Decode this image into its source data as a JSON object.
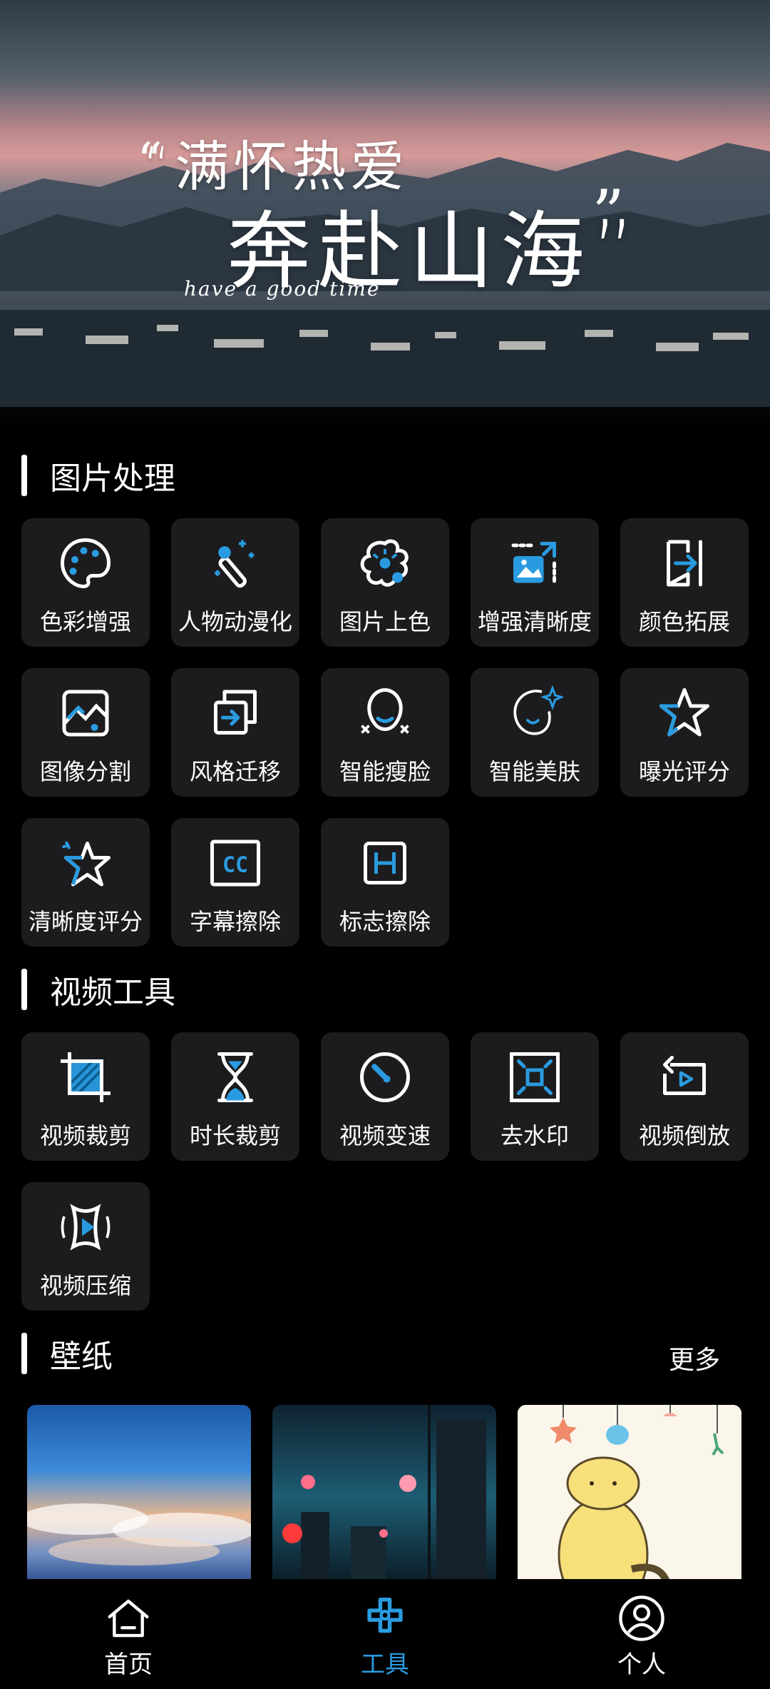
{
  "banner": {
    "line1": "“满怀热爱",
    "line2": "奔赴山海”",
    "sub": "have a good time"
  },
  "sections": {
    "image": {
      "title": "图片处理"
    },
    "video": {
      "title": "视频工具"
    },
    "wallpaper": {
      "title": "壁纸",
      "more": "更多"
    }
  },
  "image_tools": [
    {
      "label": "色彩增强",
      "icon": "palette-icon"
    },
    {
      "label": "人物动漫化",
      "icon": "magic-wand-icon"
    },
    {
      "label": "图片上色",
      "icon": "flower-color-icon"
    },
    {
      "label": "增强清晰度",
      "icon": "image-enhance-icon"
    },
    {
      "label": "颜色拓展",
      "icon": "expand-arrow-icon"
    },
    {
      "label": "图像分割",
      "icon": "image-split-icon"
    },
    {
      "label": "风格迁移",
      "icon": "style-transfer-icon"
    },
    {
      "label": "智能瘦脸",
      "icon": "face-slim-icon"
    },
    {
      "label": "智能美肤",
      "icon": "face-sparkle-icon"
    },
    {
      "label": "曝光评分",
      "icon": "star-rating-icon"
    },
    {
      "label": "清晰度评分",
      "icon": "star-sharp-icon"
    },
    {
      "label": "字幕擦除",
      "icon": "cc-icon"
    },
    {
      "label": "标志擦除",
      "icon": "logo-h-icon"
    }
  ],
  "video_tools": [
    {
      "label": "视频裁剪",
      "icon": "crop-icon"
    },
    {
      "label": "时长裁剪",
      "icon": "hourglass-icon"
    },
    {
      "label": "视频变速",
      "icon": "speed-dial-icon"
    },
    {
      "label": "去水印",
      "icon": "watermark-remove-icon"
    },
    {
      "label": "视频倒放",
      "icon": "reverse-play-icon"
    },
    {
      "label": "视频压缩",
      "icon": "compress-video-icon"
    }
  ],
  "nav": {
    "home": "首页",
    "tools": "工具",
    "profile": "个人"
  },
  "colors": {
    "accent": "#2a9be0",
    "tile_bg": "#1c1c1e",
    "background": "#000000"
  }
}
